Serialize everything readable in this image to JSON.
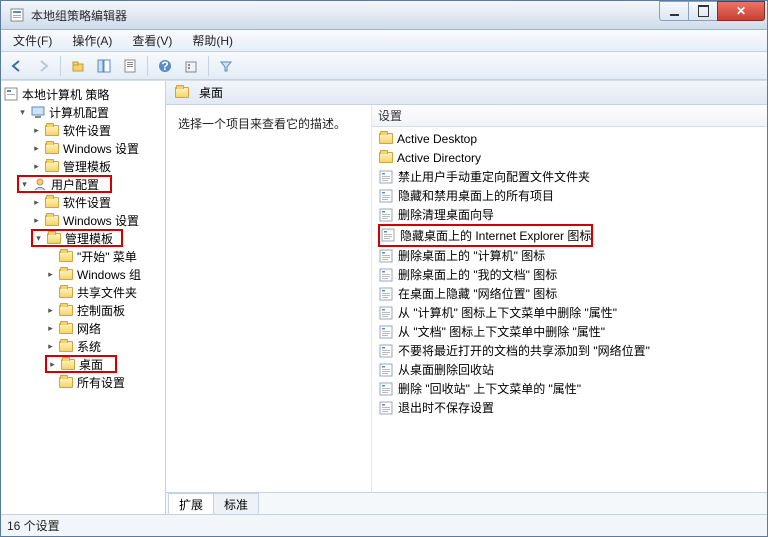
{
  "window": {
    "title": "本地组策略编辑器"
  },
  "menu": {
    "file": "文件(F)",
    "action": "操作(A)",
    "view": "查看(V)",
    "help": "帮助(H)"
  },
  "tree": {
    "root": "本地计算机 策略",
    "comp_conf": "计算机配置",
    "cc_soft": "软件设置",
    "cc_win": "Windows 设置",
    "cc_admin": "管理模板",
    "user_conf": "用户配置",
    "uc_soft": "软件设置",
    "uc_win": "Windows 设置",
    "uc_admin": "管理模板",
    "start_menu": "\"开始\" 菜单",
    "win_group": "Windows 组",
    "share": "共享文件夹",
    "ctrl": "控制面板",
    "network": "网络",
    "system": "系统",
    "desktop": "桌面",
    "allset": "所有设置"
  },
  "right": {
    "header": "桌面",
    "desc": "选择一个项目来查看它的描述。",
    "col": "设置",
    "items": [
      "Active Desktop",
      "Active Directory",
      "禁止用户手动重定向配置文件文件夹",
      "隐藏和禁用桌面上的所有项目",
      "删除清理桌面向导",
      "隐藏桌面上的 Internet Explorer 图标",
      "删除桌面上的 \"计算机\" 图标",
      "删除桌面上的 \"我的文档\" 图标",
      "在桌面上隐藏 \"网络位置\" 图标",
      "从 \"计算机\" 图标上下文菜单中删除 \"属性\"",
      "从 \"文档\" 图标上下文菜单中删除 \"属性\"",
      "不要将最近打开的文档的共享添加到 \"网络位置\"",
      "从桌面删除回收站",
      "删除 \"回收站\" 上下文菜单的 \"属性\"",
      "退出时不保存设置"
    ]
  },
  "tabs": {
    "extended": "扩展",
    "standard": "标准"
  },
  "status": "16 个设置"
}
